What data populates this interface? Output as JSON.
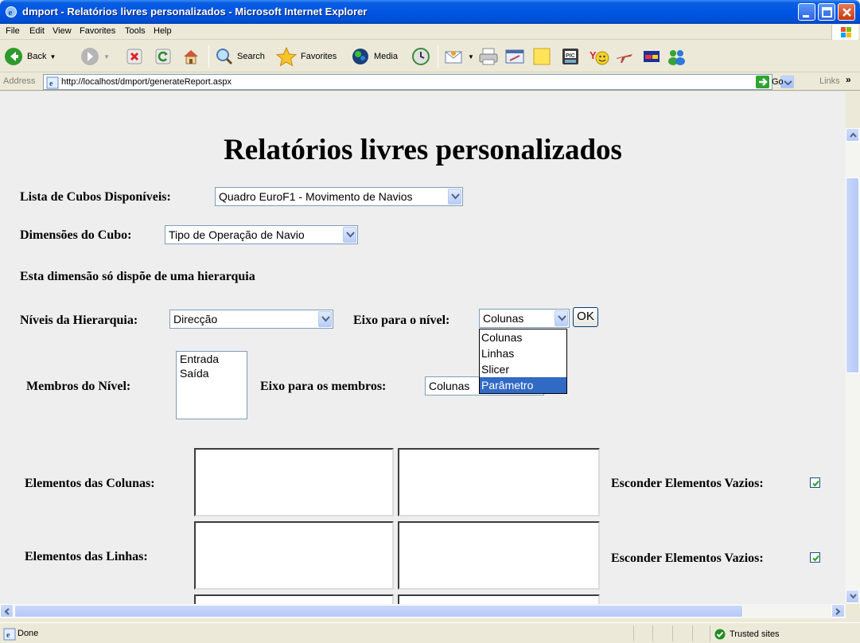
{
  "window": {
    "title": "dmport - Relatórios livres personalizados - Microsoft Internet Explorer"
  },
  "menu": [
    "File",
    "Edit",
    "View",
    "Favorites",
    "Tools",
    "Help"
  ],
  "toolbar": {
    "back_label": "Back",
    "search_label": "Search",
    "favorites_label": "Favorites",
    "media_label": "Media"
  },
  "address": {
    "label": "Address",
    "url": "http://localhost/dmport/generateReport.aspx",
    "go_label": "Go",
    "links_label": "Links"
  },
  "page": {
    "title": "Relatórios livres personalizados",
    "cubes_label": "Lista de Cubos Disponíveis:",
    "cubes_value": "Quadro EuroF1 - Movimento de Navios",
    "dimensions_label": "Dimensões do Cubo:",
    "dimensions_value": "Tipo de Operação de Navio",
    "hierarchy_note": "Esta dimensão só dispõe de uma hierarquia",
    "levels_label": "Níveis da Hierarquia:",
    "levels_value": "Direcção",
    "axis_level_label": "Eixo para o nível:",
    "axis_level_value": "Colunas",
    "ok_label": "OK",
    "axis_options": [
      "Colunas",
      "Linhas",
      "Slicer",
      "Parâmetro"
    ],
    "members_label": "Membros do Nível:",
    "members": [
      "Entrada",
      "Saída"
    ],
    "axis_members_label": "Eixo para os membros:",
    "axis_members_value": "Colunas",
    "column_elements_label": "Elementos das Colunas:",
    "row_elements_label": "Elementos das Linhas:",
    "hide_empty_label": "Esconder Elementos Vazios:",
    "hide_empty_columns_checked": true,
    "hide_empty_rows_checked": true
  },
  "status": {
    "text": "Done",
    "zone": "Trusted sites"
  }
}
